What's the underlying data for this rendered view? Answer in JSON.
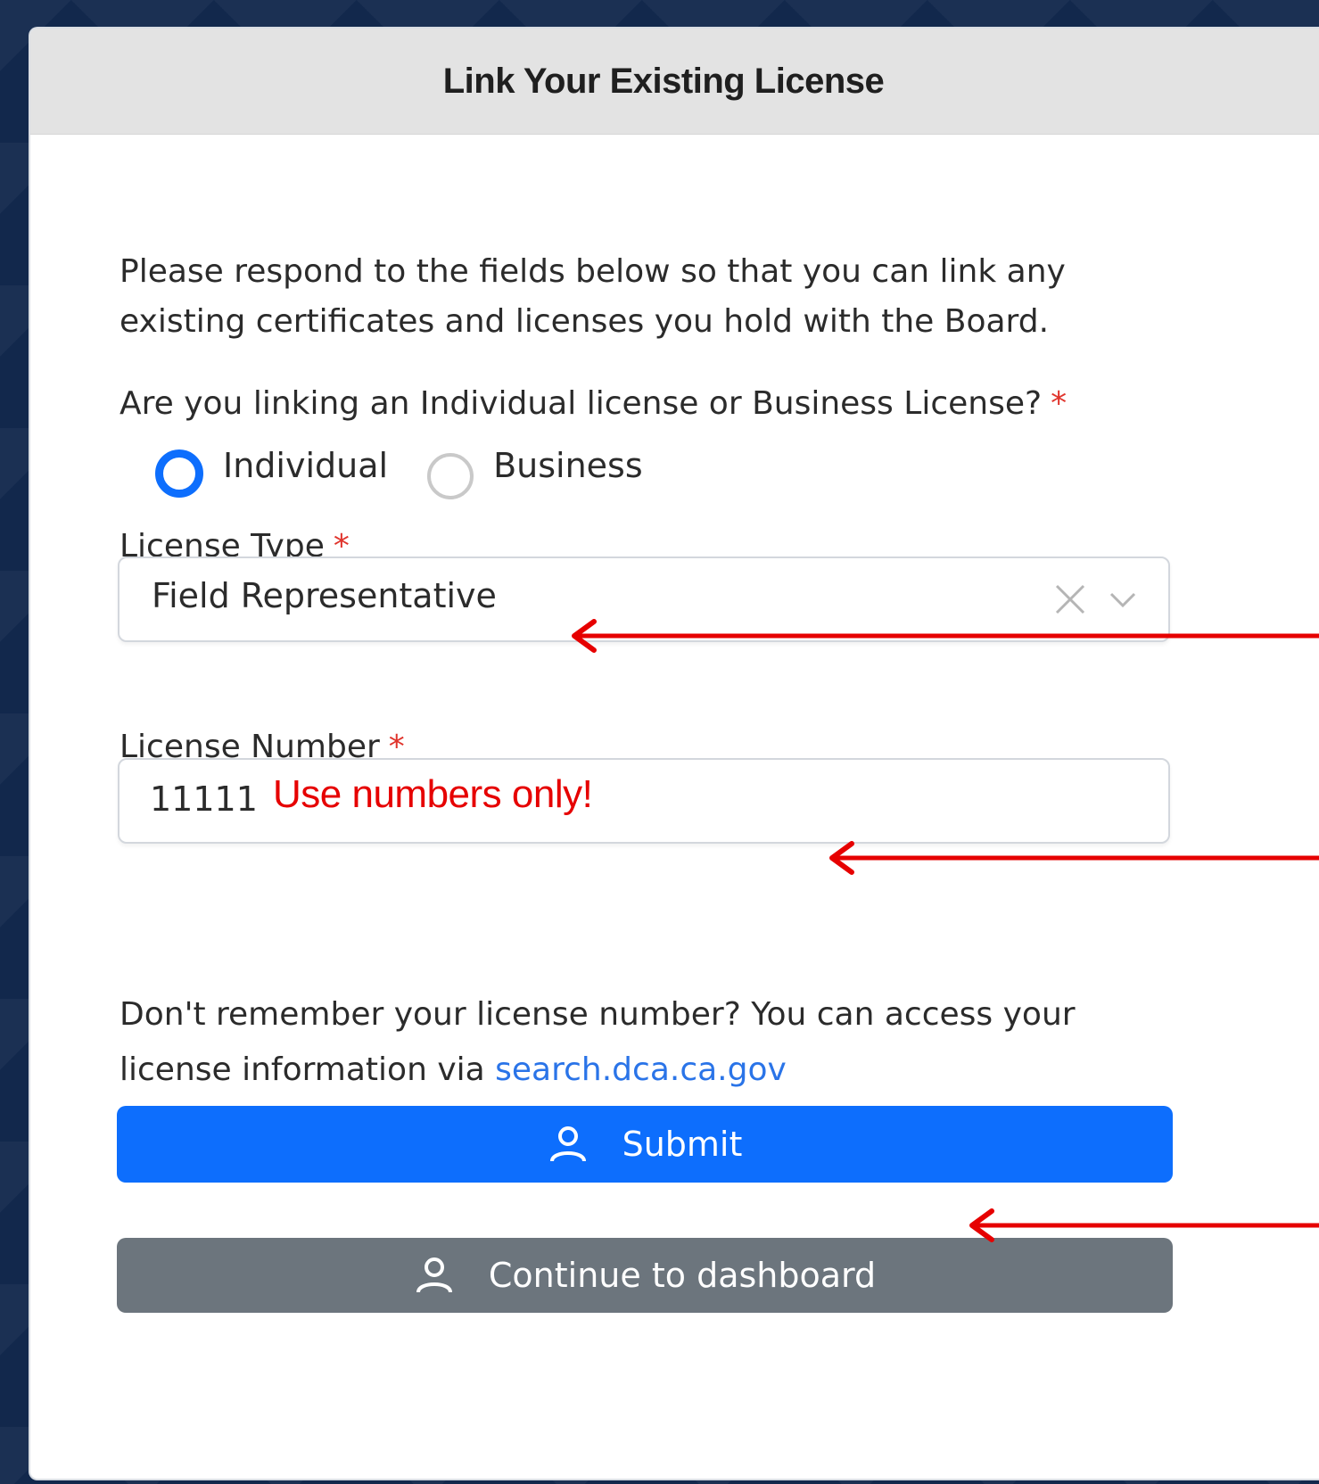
{
  "card": {
    "title": "Link Your Existing License"
  },
  "intro": {
    "text": "Please respond to the fields below so that you can link any existing certificates and licenses you hold with the Board."
  },
  "license_kind": {
    "question": "Are you linking an Individual license or Business License?",
    "required_mark": "*",
    "options": [
      {
        "label": "Individual",
        "selected": true
      },
      {
        "label": "Business",
        "selected": false
      }
    ]
  },
  "license_type": {
    "label": "License Type",
    "required_mark": "*",
    "value": "Field Representative"
  },
  "license_number": {
    "label": "License Number",
    "required_mark": "*",
    "value": "11111",
    "note": "Use numbers only!"
  },
  "help": {
    "text": "Don't remember your license number? You can access your license information via ",
    "link_text": "search.dca.ca.gov"
  },
  "buttons": {
    "submit_label": "Submit",
    "dashboard_label": "Continue to dashboard"
  },
  "icons": {
    "clear": "close-icon",
    "dropdown": "chevron-down-icon",
    "user": "user-icon",
    "annotation_arrow": "arrow-left-icon"
  },
  "colors": {
    "primary": "#0d6efd",
    "secondary": "#6c757d",
    "required": "#e0342c",
    "annotation": "#e60000",
    "link": "#2a74e8",
    "page_background": "#12284c"
  }
}
